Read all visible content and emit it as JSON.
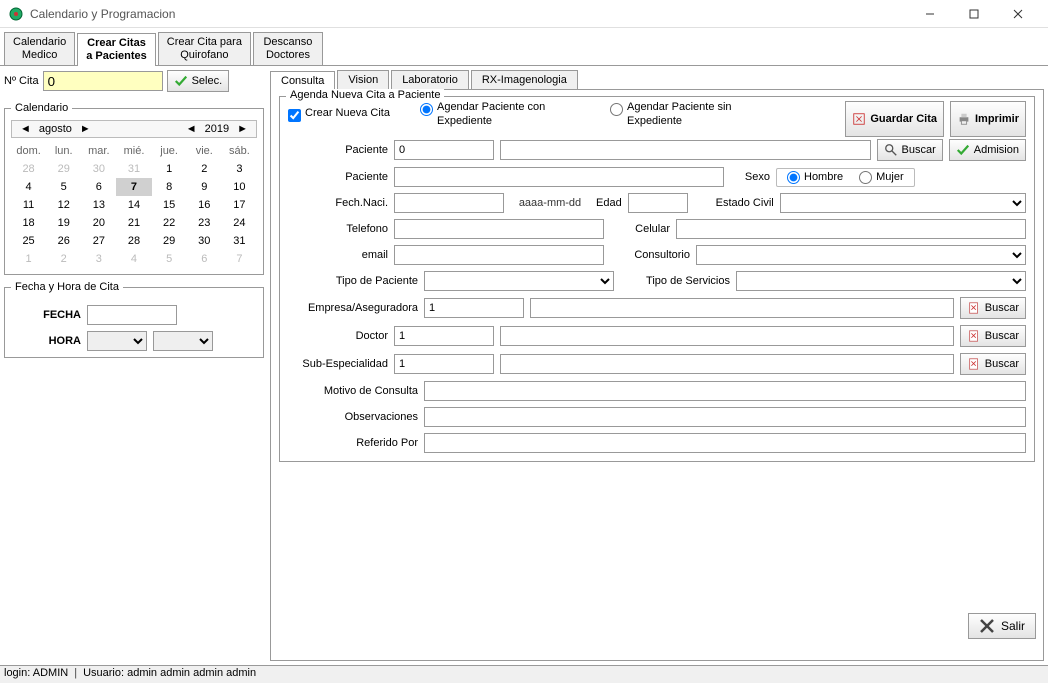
{
  "window": {
    "title": "Calendario y Programacion"
  },
  "tabs1": [
    "Calendario\nMedico",
    "Crear Citas\na Pacientes",
    "Crear Cita para\nQuirofano",
    "Descanso\nDoctores"
  ],
  "tabs1_active": 1,
  "numcita_label": "Nº Cita",
  "numcita_value": "0",
  "selec_label": "Selec.",
  "calendar": {
    "title": "Calendario",
    "month": "agosto",
    "year": "2019",
    "dow": [
      "dom.",
      "lun.",
      "mar.",
      "mié.",
      "jue.",
      "vie.",
      "sáb."
    ],
    "rows": [
      [
        {
          "v": "28",
          "o": true
        },
        {
          "v": "29",
          "o": true
        },
        {
          "v": "30",
          "o": true
        },
        {
          "v": "31",
          "o": true
        },
        {
          "v": "1"
        },
        {
          "v": "2"
        },
        {
          "v": "3"
        }
      ],
      [
        {
          "v": "4"
        },
        {
          "v": "5"
        },
        {
          "v": "6"
        },
        {
          "v": "7",
          "t": true
        },
        {
          "v": "8"
        },
        {
          "v": "9"
        },
        {
          "v": "10"
        }
      ],
      [
        {
          "v": "11"
        },
        {
          "v": "12"
        },
        {
          "v": "13"
        },
        {
          "v": "14"
        },
        {
          "v": "15"
        },
        {
          "v": "16"
        },
        {
          "v": "17"
        }
      ],
      [
        {
          "v": "18"
        },
        {
          "v": "19"
        },
        {
          "v": "20"
        },
        {
          "v": "21"
        },
        {
          "v": "22"
        },
        {
          "v": "23"
        },
        {
          "v": "24"
        }
      ],
      [
        {
          "v": "25"
        },
        {
          "v": "26"
        },
        {
          "v": "27"
        },
        {
          "v": "28"
        },
        {
          "v": "29"
        },
        {
          "v": "30"
        },
        {
          "v": "31"
        }
      ],
      [
        {
          "v": "1",
          "o": true
        },
        {
          "v": "2",
          "o": true
        },
        {
          "v": "3",
          "o": true
        },
        {
          "v": "4",
          "o": true
        },
        {
          "v": "5",
          "o": true
        },
        {
          "v": "6",
          "o": true
        },
        {
          "v": "7",
          "o": true
        }
      ]
    ]
  },
  "fechahora": {
    "title": "Fecha y Hora de Cita",
    "fecha_label": "FECHA",
    "hora_label": "HORA"
  },
  "tabs2": [
    "Consulta",
    "Vision",
    "Laboratorio",
    "RX-Imagenologia"
  ],
  "tabs2_active": 0,
  "agenda_title": "Agenda Nueva Cita a Paciente",
  "opt_crear": "Crear Nueva Cita",
  "opt_conexp": "Agendar Paciente con Expediente",
  "opt_sinexp": "Agendar Paciente sin Expediente",
  "btn_guardar": "Guardar Cita",
  "btn_imprimir": "Imprimir",
  "btn_buscar": "Buscar",
  "btn_admision": "Admision",
  "btn_salir": "Salir",
  "labels": {
    "paciente": "Paciente",
    "sexo": "Sexo",
    "hombre": "Hombre",
    "mujer": "Mujer",
    "fechnaci": "Fech.Naci.",
    "fechph": "aaaa-mm-dd",
    "edad": "Edad",
    "estadocivil": "Estado Civil",
    "telefono": "Telefono",
    "celular": "Celular",
    "email": "email",
    "consultorio": "Consultorio",
    "tipopaciente": "Tipo de Paciente",
    "tiposervicios": "Tipo de Servicios",
    "empresa": "Empresa/Aseguradora",
    "doctor": "Doctor",
    "subesp": "Sub-Especialidad",
    "motivo": "Motivo de Consulta",
    "observ": "Observaciones",
    "referido": "Referido Por"
  },
  "values": {
    "paciente_id": "0",
    "empresa_id": "1",
    "doctor_id": "1",
    "subesp_id": "1"
  },
  "status": {
    "login": "login: ADMIN",
    "usuario": "Usuario: admin admin admin admin"
  }
}
